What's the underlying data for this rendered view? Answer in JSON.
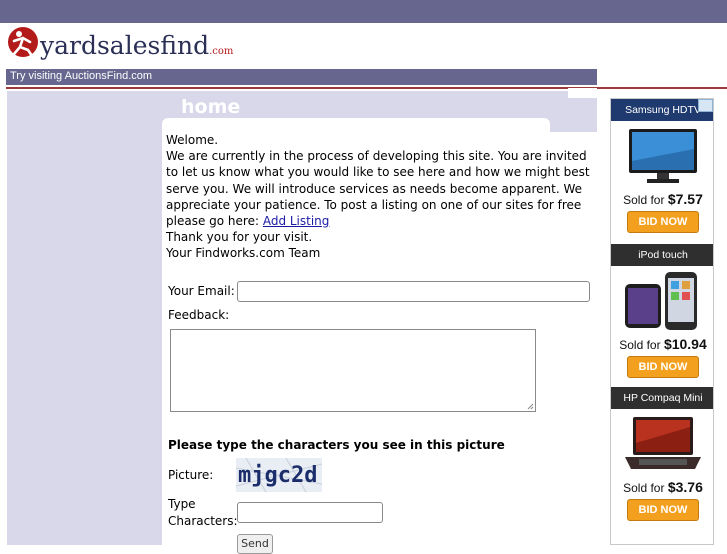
{
  "header": {
    "logo_text": "yardsalesfind",
    "logo_suffix": ".com",
    "nav_link": "Try visiting AuctionsFind.com"
  },
  "main": {
    "heading": "home",
    "intro": {
      "greeting": "Welome.",
      "paragraph": "We are currently in the process of developing this site. You are invited to let us know what you would like to see here and how we might best serve you. We will introduce services as needs become apparent. We appreciate your patience. To post a listing on one of our sites for free please go here:",
      "link_text": "Add Listing",
      "thanks": "Thank you for your visit.",
      "signature": "Your Findworks.com Team"
    },
    "form": {
      "email_label": "Your Email:",
      "email_value": "",
      "feedback_label": "Feedback:",
      "feedback_value": "",
      "captcha_title": "Please type the characters you see in this picture",
      "picture_label": "Picture:",
      "captcha_code": "mjgc2d",
      "type_label_line1": "Type",
      "type_label_line2": "Characters:",
      "type_value": "",
      "send_label": "Send"
    }
  },
  "ad": {
    "items": [
      {
        "title": "Samsung HDTV",
        "sold_prefix": "Sold for ",
        "price": "$7.57",
        "bid_label": "BID NOW",
        "icon": "tv-icon"
      },
      {
        "title": "iPod touch",
        "sold_prefix": "Sold for ",
        "price": "$10.94",
        "bid_label": "BID NOW",
        "icon": "ipod-icon"
      },
      {
        "title": "HP Compaq Mini",
        "sold_prefix": "Sold for ",
        "price": "$3.76",
        "bid_label": "BID NOW",
        "icon": "laptop-icon"
      }
    ]
  },
  "colors": {
    "topbar": "#66668f",
    "sidebar": "#d8d8ea",
    "accent_red": "#9c3b3b",
    "bid_orange": "#f3a01e"
  }
}
